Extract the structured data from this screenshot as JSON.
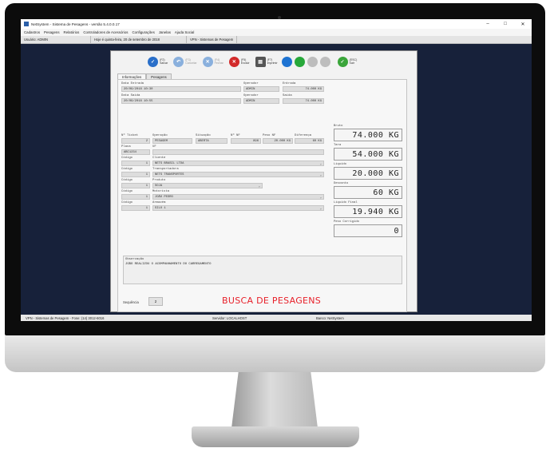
{
  "window": {
    "title": "NetSystem - Sistema de Pesagens - versão 5.4.0.0.17",
    "controls": [
      "–",
      "□",
      "✕"
    ]
  },
  "menu": [
    "Cadastros",
    "Pesagens",
    "Relatórios",
    "Controladores de Acessórios",
    "Configurações",
    "Janelas",
    "Ajuda Social"
  ],
  "infobar": [
    "Usuário: ADMIN",
    "Hoje é quinta-feira, 20 de setembro de 2018",
    "VPN - Sistemas de Pesagem"
  ],
  "toolbar": {
    "buttons": [
      {
        "icon": "save-icon",
        "label": "(F2)\nSalvar",
        "dim": false,
        "color": "#2a6fc9",
        "glyph": "✓"
      },
      {
        "icon": "cancel-icon",
        "label": "(F3)\nCancelar",
        "dim": true,
        "color": "#8ab0dd",
        "glyph": "↶"
      },
      {
        "icon": "close-icon",
        "label": "(F4)\nFechar",
        "dim": true,
        "color": "#8ab0dd",
        "glyph": "✕"
      },
      {
        "icon": "delete-icon",
        "label": "(F5)\nExcluir",
        "dim": false,
        "color": "#d22a2a",
        "glyph": "✕"
      },
      {
        "icon": "printer-icon",
        "label": "(F7)\nImprimir",
        "dim": false,
        "color": "#555555",
        "glyph": "▤"
      }
    ],
    "nav_colors": [
      "#1e73d2",
      "#27a83a",
      "#bdbdbd",
      "#bdbdbd"
    ],
    "exit": {
      "icon": "exit-icon",
      "label": "(ESC)\nSair",
      "color": "#3aa53a",
      "glyph": "✓"
    }
  },
  "tabs": [
    {
      "label": "Informações",
      "active": true
    },
    {
      "label": "Pesagens",
      "active": false
    }
  ],
  "entrada": {
    "date_label": "Data Entrada",
    "date": "20/09/2018 10:30",
    "operator_label": "Operador",
    "operator": "ADMIN",
    "weight_label": "Entrada",
    "weight": "74.000 KG"
  },
  "saida": {
    "date_label": "Data Saída",
    "date": "20/09/2018 10:55",
    "operator_label": "Operador",
    "operator": "ADMIN",
    "weight_label": "Saída",
    "weight": "74.000 KG"
  },
  "ticket": {
    "headers": [
      "Nº Ticket",
      "Operação",
      "Situação",
      "Nº NF",
      "Peso NF",
      "Diferença"
    ],
    "values": [
      "2",
      "PESAGEM",
      "ABERTA",
      "896",
      "20.000 KG",
      "60 KG"
    ]
  },
  "placa": {
    "label": "Placa",
    "value": "ABC1234",
    "extra_label": "UF"
  },
  "cliente": {
    "code_label": "Código",
    "label": "Cliente",
    "code": "1",
    "name": "NETS BRASIL LTDA"
  },
  "transportadora": {
    "code_label": "Código",
    "label": "Transportadora",
    "code": "1",
    "name": "NETS TRANSPORTES"
  },
  "produto": {
    "code_label": "Código",
    "label": "Produto",
    "code": "1",
    "name": "SOJA",
    "button": "Balança Pesagem"
  },
  "motorista": {
    "code_label": "Código",
    "label": "Motorista",
    "code": "1",
    "name": "JOÃO PEDRO"
  },
  "armazem": {
    "code_label": "Código",
    "label": "Armazém",
    "code": "1",
    "name": "SILO 1"
  },
  "weights": [
    {
      "label": "Bruto",
      "value": "74.000 KG"
    },
    {
      "label": "Tara",
      "value": "54.000 KG"
    },
    {
      "label": "Líquido",
      "value": "20.000 KG"
    },
    {
      "label": "Desconto",
      "value": "60 KG"
    },
    {
      "label": "Líquido Final",
      "value": "19.940 KG"
    },
    {
      "label": "Peso Corrigido",
      "value": "0"
    }
  ],
  "observacao": {
    "label": "Observação",
    "text": "JOÃO REALIZOU O ACOMPANHAMENTO DO CARREGAMENTO"
  },
  "sequencia": {
    "label": "Sequência",
    "value": "2"
  },
  "search_title": "BUSCA DE PESAGENS",
  "statusbar": [
    "VPN - Sistemas de Pesagem - Fone: (14) 3012-6016",
    "Servidor: LOCALHOST",
    "Banco: NetSystem"
  ]
}
